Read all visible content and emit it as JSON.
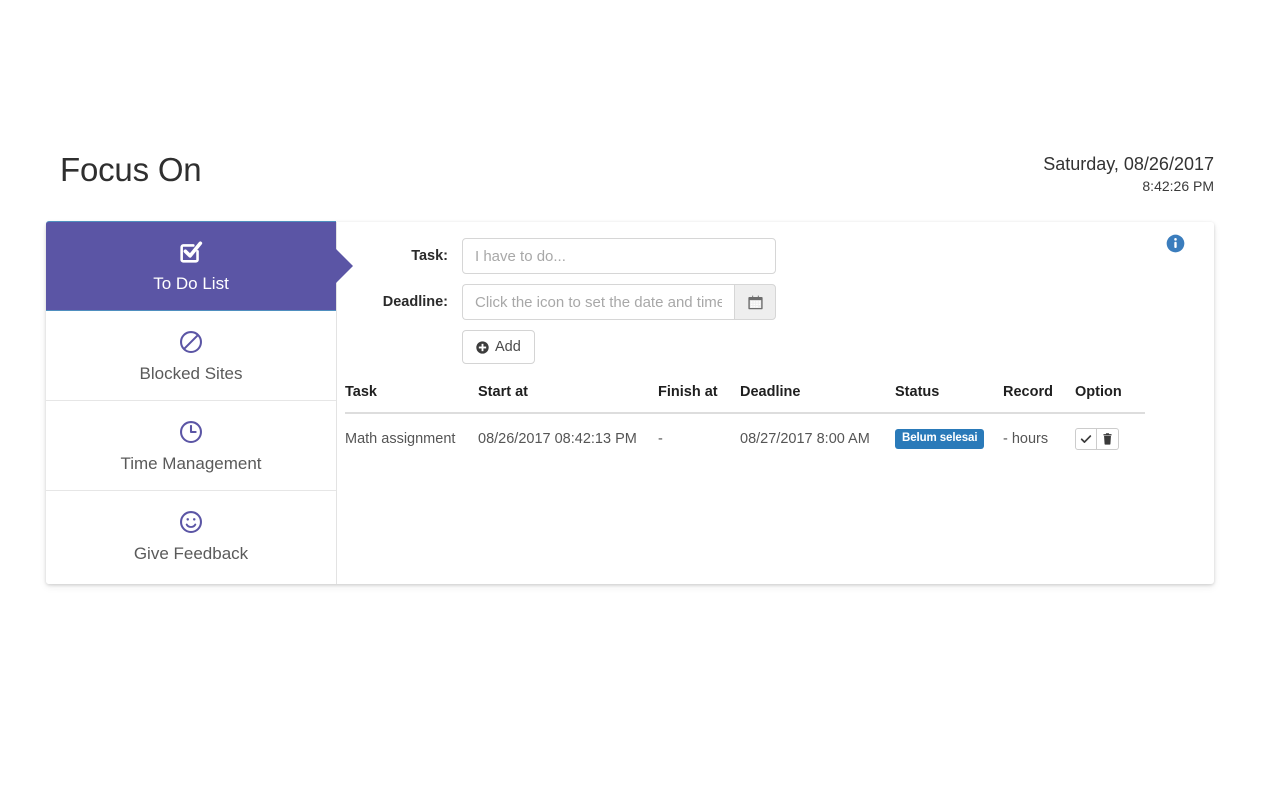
{
  "header": {
    "app_title": "Focus On",
    "date": "Saturday, 08/26/2017",
    "time": "8:42:26 PM"
  },
  "sidebar": {
    "items": [
      {
        "label": "To Do List",
        "icon": "checkbox-checked-icon",
        "active": true
      },
      {
        "label": "Blocked Sites",
        "icon": "ban-icon",
        "active": false
      },
      {
        "label": "Time Management",
        "icon": "clock-icon",
        "active": false
      },
      {
        "label": "Give Feedback",
        "icon": "smiley-icon",
        "active": false
      }
    ]
  },
  "form": {
    "task_label": "Task:",
    "task_value": "",
    "task_placeholder": "I have to do...",
    "deadline_label": "Deadline:",
    "deadline_value": "",
    "deadline_placeholder": "Click the icon to set the date and time",
    "calendar_icon": "calendar-icon",
    "add_label": "Add",
    "add_icon": "plus-circle-icon",
    "info_icon": "info-circle-icon"
  },
  "table": {
    "columns": [
      "Task",
      "Start at",
      "Finish at",
      "Deadline",
      "Status",
      "Record",
      "Option"
    ],
    "rows": [
      {
        "task": "Math assignment",
        "start_at": "08/26/2017 08:42:13 PM",
        "finish_at": "-",
        "deadline": "08/27/2017 8:00 AM",
        "status": "Belum selesai",
        "record": "- hours",
        "option_done_icon": "check-icon",
        "option_delete_icon": "trash-icon"
      }
    ]
  },
  "colors": {
    "accent_purple": "#5b55a5",
    "badge_blue": "#2a7ab9",
    "info_blue": "#3b7dbd",
    "text_dark": "#2f2f2f",
    "text_muted": "#555555"
  }
}
